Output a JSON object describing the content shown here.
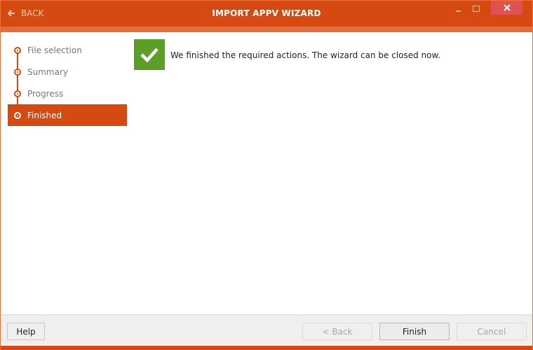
{
  "window": {
    "title": "IMPORT APPV WIZARD",
    "back_label": "BACK",
    "colors": {
      "accent": "#d64910",
      "accent_light": "#e56c3c",
      "close_button": "#e05151",
      "success": "#5d9e28"
    }
  },
  "sidebar": {
    "steps": [
      {
        "label": "File selection",
        "active": false
      },
      {
        "label": "Summary",
        "active": false
      },
      {
        "label": "Progress",
        "active": false
      },
      {
        "label": "Finished",
        "active": true
      }
    ]
  },
  "content": {
    "status_icon": "checkmark-icon",
    "message": "We finished the required actions. The wizard can be closed now."
  },
  "footer": {
    "help_label": "Help",
    "back_label": "< Back",
    "finish_label": "Finish",
    "cancel_label": "Cancel"
  }
}
